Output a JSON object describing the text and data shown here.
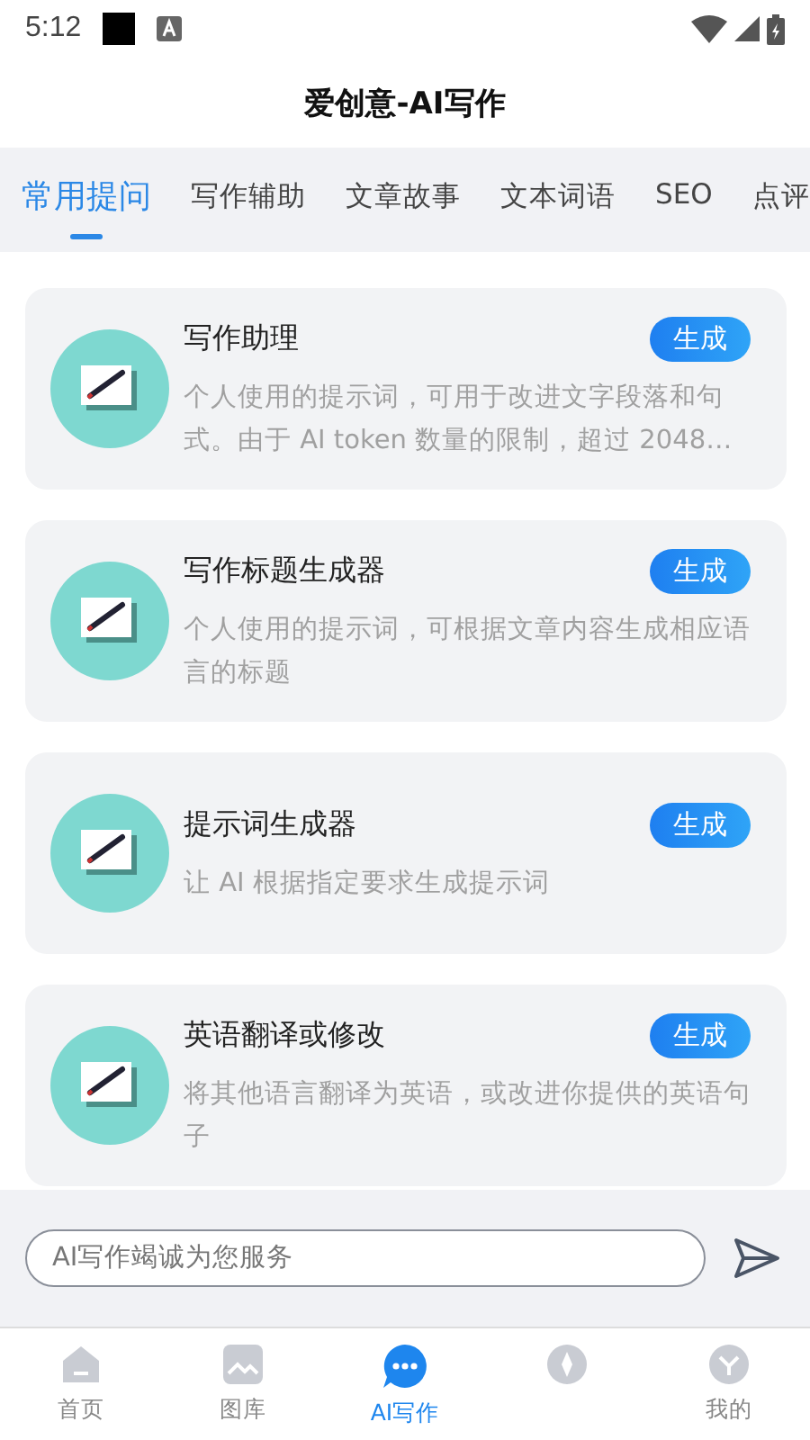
{
  "status_bar": {
    "time": "5:12"
  },
  "title": "爱创意-AI写作",
  "tabs": [
    {
      "label": "常用提问",
      "selected": true
    },
    {
      "label": "写作辅助",
      "selected": false
    },
    {
      "label": "文章故事",
      "selected": false
    },
    {
      "label": "文本词语",
      "selected": false
    },
    {
      "label": "SEO",
      "selected": false
    },
    {
      "label": "点评",
      "selected": false
    }
  ],
  "cards": [
    {
      "title": "写作助理",
      "description": "个人使用的提示词，可用于改进文字段落和句式。由于 AI token 数量的限制，超过 2048…",
      "button": "生成"
    },
    {
      "title": "写作标题生成器",
      "description": "个人使用的提示词，可根据文章内容生成相应语言的标题",
      "button": "生成"
    },
    {
      "title": "提示词生成器",
      "description": "让 AI 根据指定要求生成提示词",
      "button": "生成"
    },
    {
      "title": "英语翻译或修改",
      "description": "将其他语言翻译为英语，或改进你提供的英语句子",
      "button": "生成"
    }
  ],
  "input": {
    "placeholder": "AI写作竭诚为您服务"
  },
  "nav": [
    {
      "kind": "home",
      "label": "首页",
      "selected": false
    },
    {
      "kind": "gallery",
      "label": "图库",
      "selected": false
    },
    {
      "kind": "chat",
      "label": "AI写作",
      "selected": true
    },
    {
      "kind": "community",
      "selected": false
    },
    {
      "kind": "profile",
      "label": "我的",
      "selected": false
    }
  ]
}
